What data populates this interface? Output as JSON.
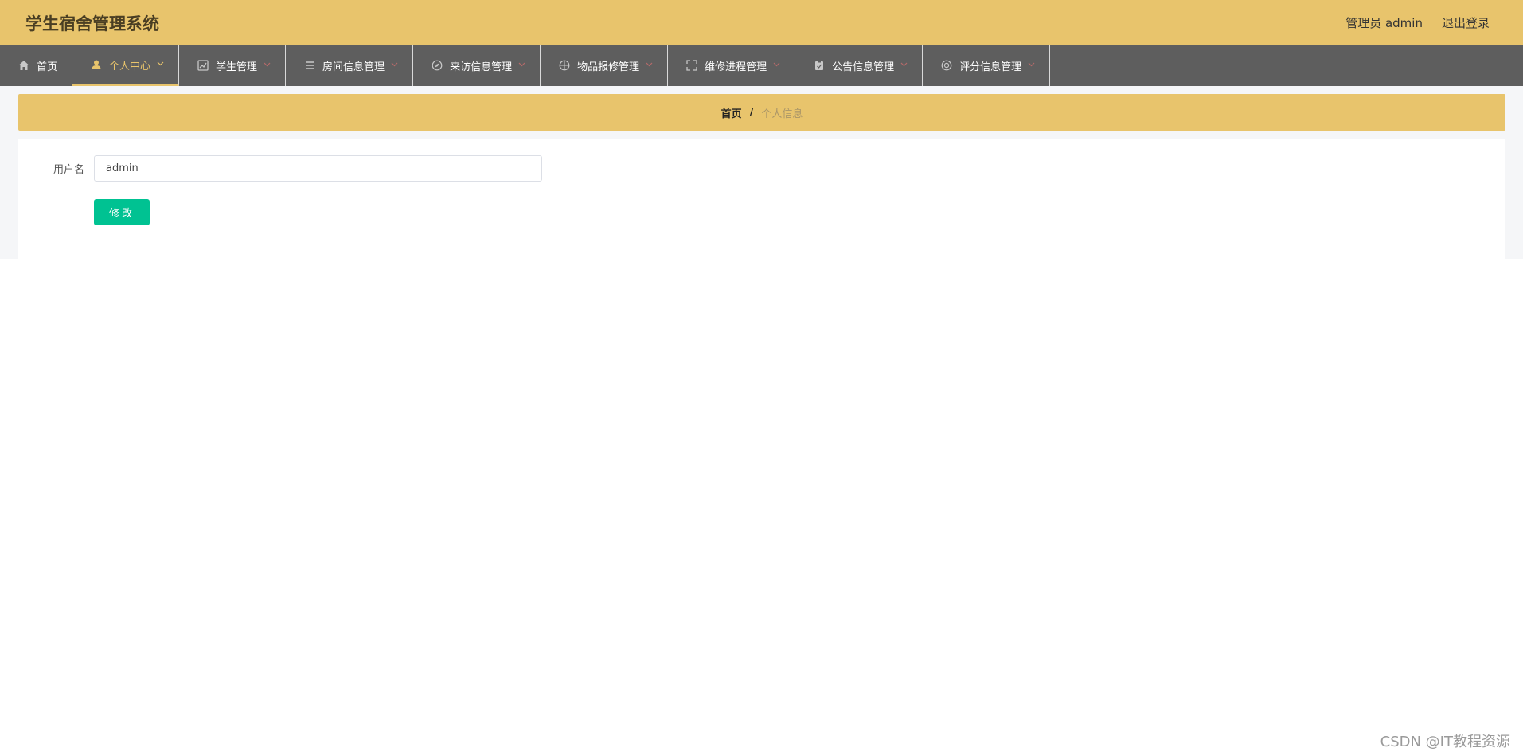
{
  "header": {
    "title": "学生宿舍管理系统",
    "user_label": "管理员 admin",
    "logout_label": "退出登录"
  },
  "nav": {
    "items": [
      {
        "label": "首页",
        "icon": "home-icon",
        "active": false,
        "has_dropdown": false
      },
      {
        "label": "个人中心",
        "icon": "user-icon",
        "active": true,
        "has_dropdown": true
      },
      {
        "label": "学生管理",
        "icon": "chart-icon",
        "active": false,
        "has_dropdown": true
      },
      {
        "label": "房间信息管理",
        "icon": "list-icon",
        "active": false,
        "has_dropdown": true
      },
      {
        "label": "来访信息管理",
        "icon": "compass-icon",
        "active": false,
        "has_dropdown": true
      },
      {
        "label": "物品报修管理",
        "icon": "aperture-icon",
        "active": false,
        "has_dropdown": true
      },
      {
        "label": "维修进程管理",
        "icon": "fullscreen-icon",
        "active": false,
        "has_dropdown": true
      },
      {
        "label": "公告信息管理",
        "icon": "clipboard-icon",
        "active": false,
        "has_dropdown": true
      },
      {
        "label": "评分信息管理",
        "icon": "lifebuoy-icon",
        "active": false,
        "has_dropdown": true
      }
    ]
  },
  "breadcrumb": {
    "home": "首页",
    "separator": "/",
    "current": "个人信息"
  },
  "form": {
    "username_label": "用户名",
    "username_value": "admin",
    "submit_label": "修改"
  },
  "watermark": "CSDN @IT教程资源",
  "colors": {
    "header_bg": "#e8c46c",
    "nav_bg": "#5e5e5e",
    "accent": "#e8c46c",
    "submit_bg": "#00c292"
  }
}
